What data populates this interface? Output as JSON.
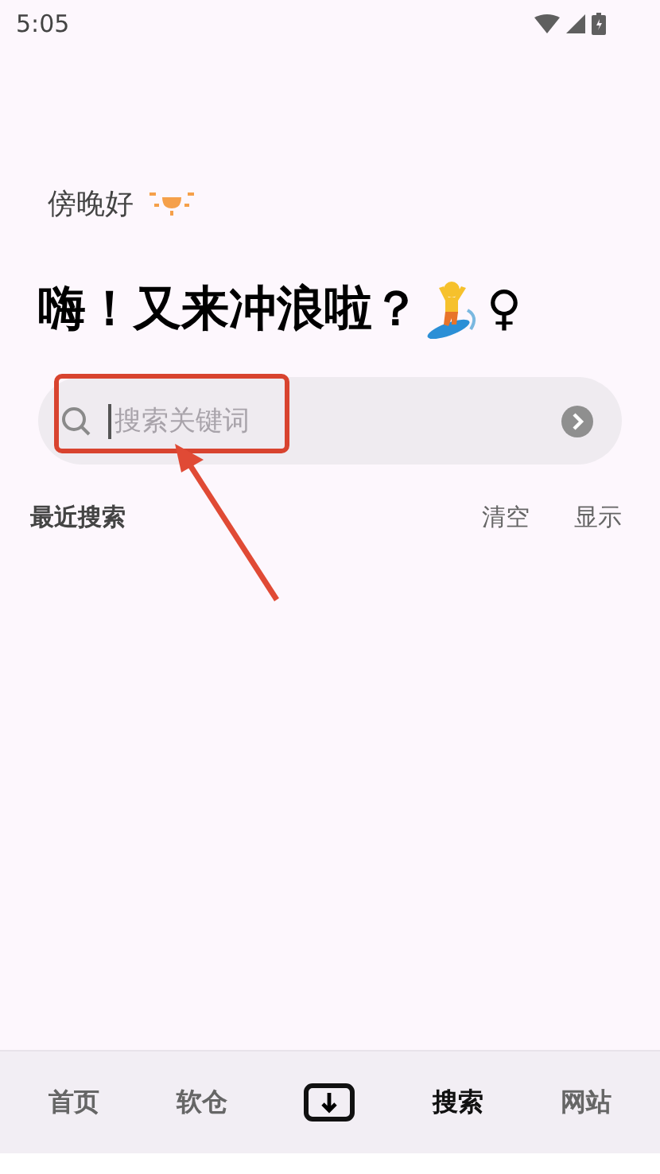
{
  "status_bar": {
    "time": "5:05"
  },
  "greeting": {
    "text": "傍晚好"
  },
  "headline": {
    "text": "嗨！又来冲浪啦？",
    "symbol": "♀"
  },
  "search": {
    "placeholder": "搜索关键词",
    "focused": true
  },
  "recent": {
    "title": "最近搜索",
    "actions": [
      "清空",
      "显示"
    ]
  },
  "annotation": {
    "kind": "highlight-with-arrow"
  },
  "bottom_nav": [
    {
      "kind": "text",
      "label": "首页",
      "selected": false
    },
    {
      "kind": "text",
      "label": "软仓",
      "selected": false
    },
    {
      "kind": "download",
      "selected": false
    },
    {
      "kind": "text",
      "label": "搜索",
      "selected": true
    },
    {
      "kind": "text",
      "label": "网站",
      "selected": false
    }
  ]
}
